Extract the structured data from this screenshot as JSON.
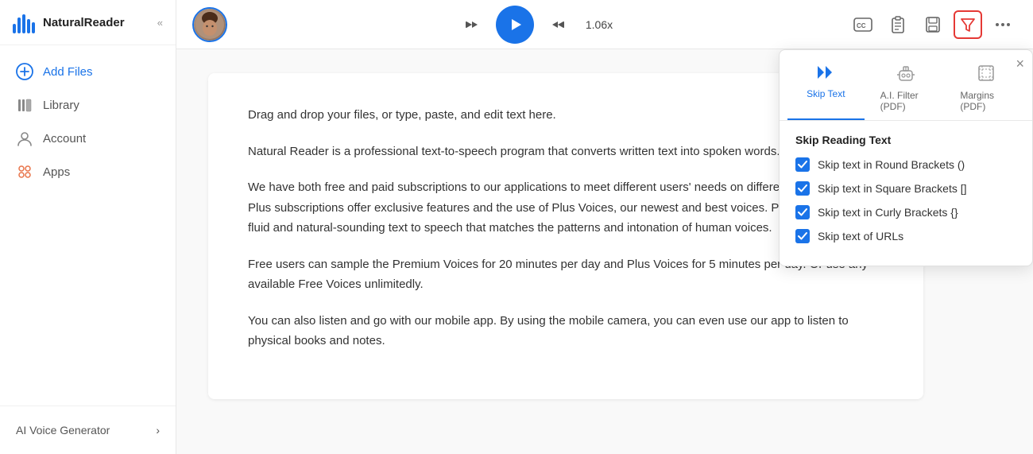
{
  "app": {
    "name": "NaturalReader",
    "logo_text": "NaturalReader"
  },
  "sidebar": {
    "collapse_label": "«",
    "items": [
      {
        "id": "add-files",
        "label": "Add Files",
        "icon": "plus-circle"
      },
      {
        "id": "library",
        "label": "Library",
        "icon": "library"
      },
      {
        "id": "account",
        "label": "Account",
        "icon": "user"
      },
      {
        "id": "apps",
        "label": "Apps",
        "icon": "apps"
      }
    ],
    "footer": {
      "ai_voice_label": "AI Voice Generator",
      "chevron": "›"
    }
  },
  "header": {
    "speed": "1.06x",
    "play_label": "Play",
    "rewind_label": "Rewind",
    "forward_label": "Forward",
    "cc_label": "Closed Captions",
    "clipboard_label": "Clipboard",
    "save_label": "Save",
    "filter_label": "Filter",
    "more_label": "More"
  },
  "dropdown": {
    "close_label": "×",
    "tabs": [
      {
        "id": "skip-text",
        "label": "Skip Text",
        "icon": "skip"
      },
      {
        "id": "ai-filter",
        "label": "A.I. Filter (PDF)",
        "icon": "robot"
      },
      {
        "id": "margins",
        "label": "Margins (PDF)",
        "icon": "margins"
      }
    ],
    "active_tab": "skip-text",
    "title": "Skip Reading Text",
    "options": [
      {
        "id": "round",
        "label": "Skip text in Round Brackets ()",
        "checked": true
      },
      {
        "id": "square",
        "label": "Skip text in Square Brackets []",
        "checked": true
      },
      {
        "id": "curly",
        "label": "Skip text in Curly Brackets {}",
        "checked": true
      },
      {
        "id": "urls",
        "label": "Skip text of URLs",
        "checked": true
      }
    ]
  },
  "document": {
    "paragraphs": [
      "Drag and drop your files, or type, paste, and edit text here.",
      "Natural Reader is a professional text-to-speech program that converts written text into spoken words.",
      "We have both free and paid subscriptions to our applications to meet different users' needs on different budgets. Our Plus subscriptions offer exclusive features and the use of Plus Voices, our newest and best voices. Plus Voices enable fluid and natural-sounding text to speech that matches the patterns and intonation of human voices.",
      "Free users can sample the Premium Voices for 20 minutes per day and Plus Voices for 5 minutes per day. Or use any available Free Voices unlimitedly.",
      "You can also listen and go with our mobile app. By using the mobile camera, you can even use our app to listen to physical books and notes."
    ]
  },
  "colors": {
    "brand_blue": "#1a73e8",
    "active_red": "#e53935"
  }
}
